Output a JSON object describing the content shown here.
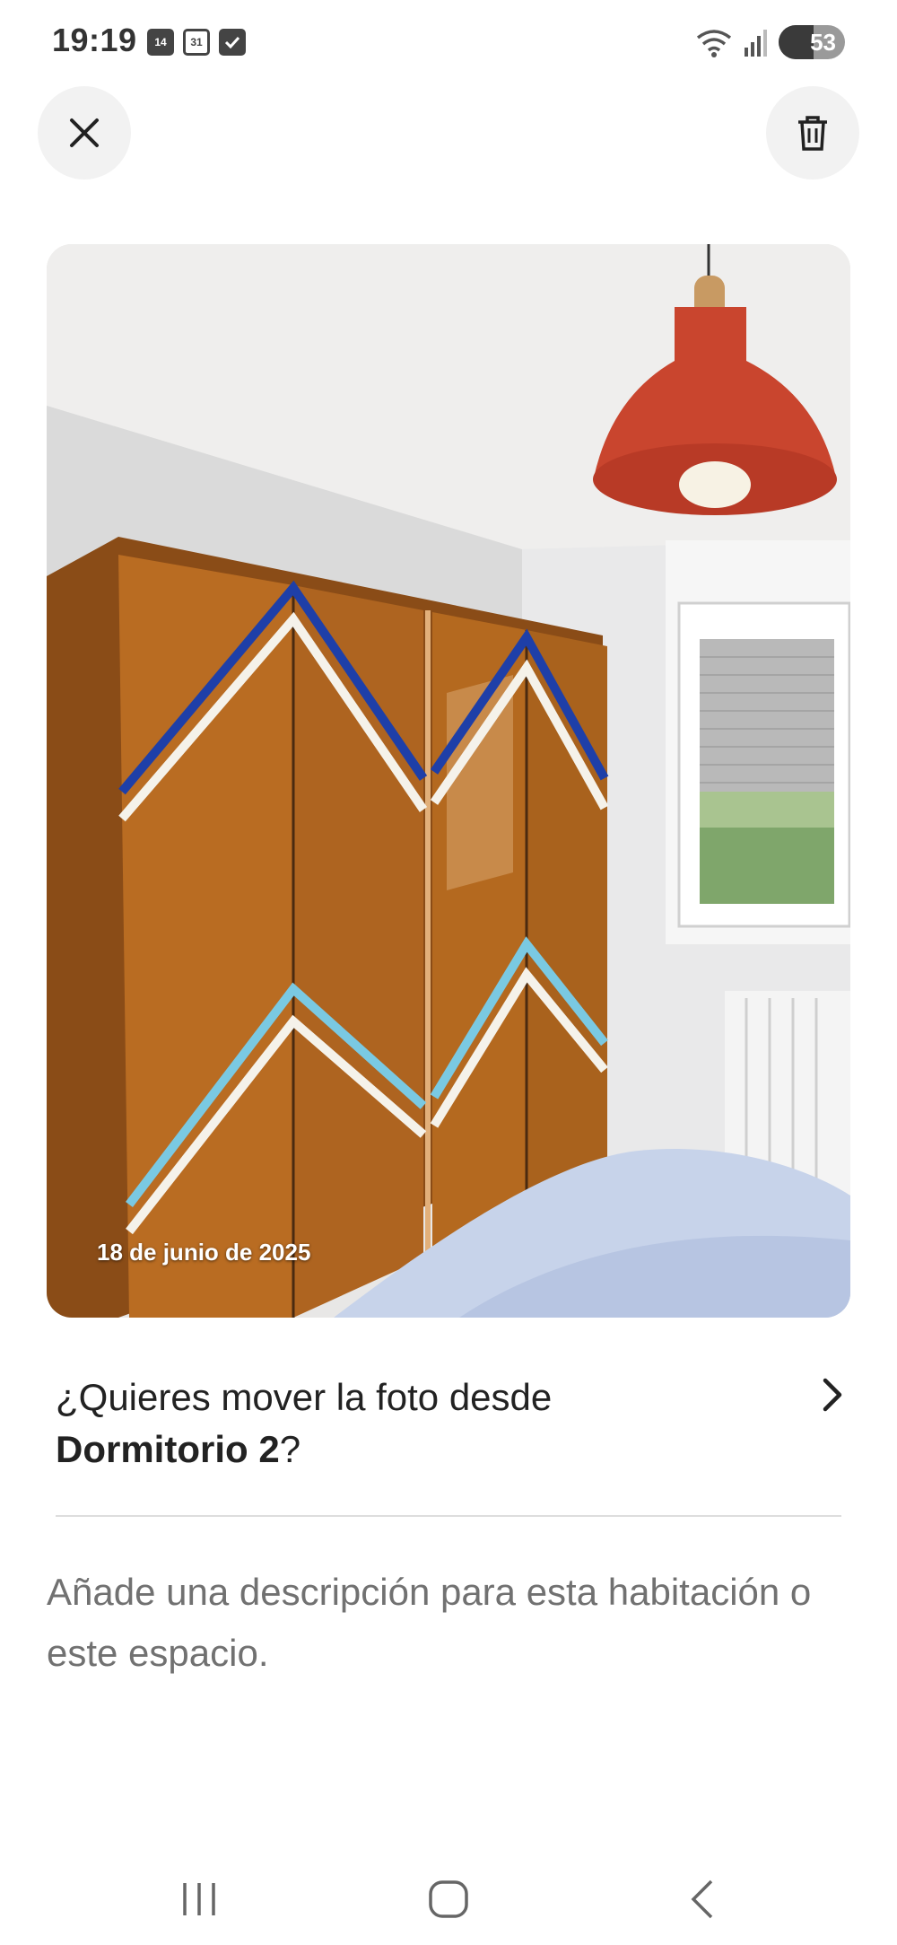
{
  "status_bar": {
    "time": "19:19",
    "calendar_day_1": "14",
    "calendar_day_2": "31",
    "battery_level": "53",
    "battery_fraction": 0.53
  },
  "header": {
    "close_icon": "close-icon",
    "delete_icon": "trash-icon"
  },
  "photo": {
    "date_label": "18 de junio de 2025"
  },
  "move_photo": {
    "prefix": "¿Quieres mover la foto desde",
    "room": "Dormitorio 2",
    "suffix": "?"
  },
  "description": {
    "placeholder": "Añade una descripción para esta habitación o este espacio."
  },
  "nav_bar": {
    "recent_icon": "recent-apps-icon",
    "home_icon": "home-icon",
    "back_icon": "back-icon"
  }
}
